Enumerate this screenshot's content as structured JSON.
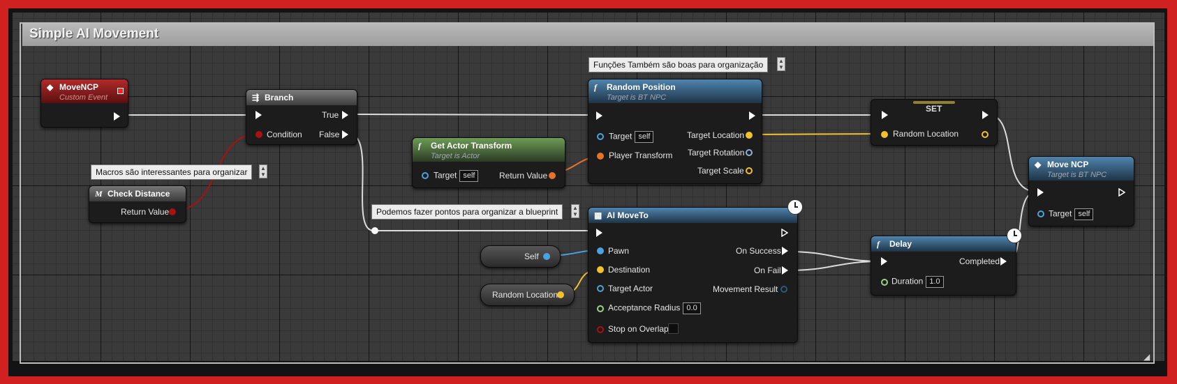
{
  "colors": {
    "frame": "#d12020",
    "event": "#8b1a1a",
    "branch": "#6e6e6e",
    "function": "#3d6a8e",
    "pure": "#4f7a3c",
    "macro": "#5a5a5a",
    "exec": "#ffffff",
    "vector": "#f2c12e",
    "transform": "#e8722b",
    "object": "#4aa3df",
    "float": "#9ad08a",
    "bool": "#a11"
  },
  "comment": {
    "title": "Simple AI Movement"
  },
  "notes": {
    "functions": "Funções Também são boas para organização",
    "macros": "Macros são interessantes para organizar",
    "reroute": "Podemos fazer pontos para organizar a blueprint"
  },
  "nodes": {
    "event": {
      "title": "MoveNCP",
      "subtitle": "Custom Event"
    },
    "branch": {
      "title": "Branch",
      "true": "True",
      "condition": "Condition",
      "false": "False"
    },
    "check": {
      "title": "Check Distance",
      "return": "Return Value"
    },
    "actor": {
      "title": "Get Actor Transform",
      "subtitle": "Target is Actor",
      "target": "Target",
      "target_val": "self",
      "return": "Return Value"
    },
    "random": {
      "title": "Random Position",
      "subtitle": "Target is BT NPC",
      "target": "Target",
      "target_val": "self",
      "player": "Player Transform",
      "loc": "Target Location",
      "rot": "Target Rotation",
      "scale": "Target Scale"
    },
    "set": {
      "title": "SET",
      "var": "Random Location"
    },
    "move": {
      "title": "Move NCP",
      "subtitle": "Target is BT NPC",
      "target": "Target",
      "target_val": "self"
    },
    "ai": {
      "title": "AI MoveTo",
      "pawn": "Pawn",
      "dest": "Destination",
      "tactor": "Target Actor",
      "radius": "Acceptance Radius",
      "radius_val": "0.0",
      "overlap": "Stop on Overlap",
      "success": "On Success",
      "fail": "On Fail",
      "result": "Movement Result"
    },
    "delay": {
      "title": "Delay",
      "completed": "Completed",
      "duration": "Duration",
      "duration_val": "1.0"
    }
  },
  "vars": {
    "self": "Self",
    "random": "Random Location"
  },
  "icons": [
    "custom-event-icon",
    "branch-icon",
    "macro-icon",
    "function-icon",
    "clock-icon",
    "resize-grip-icon"
  ]
}
